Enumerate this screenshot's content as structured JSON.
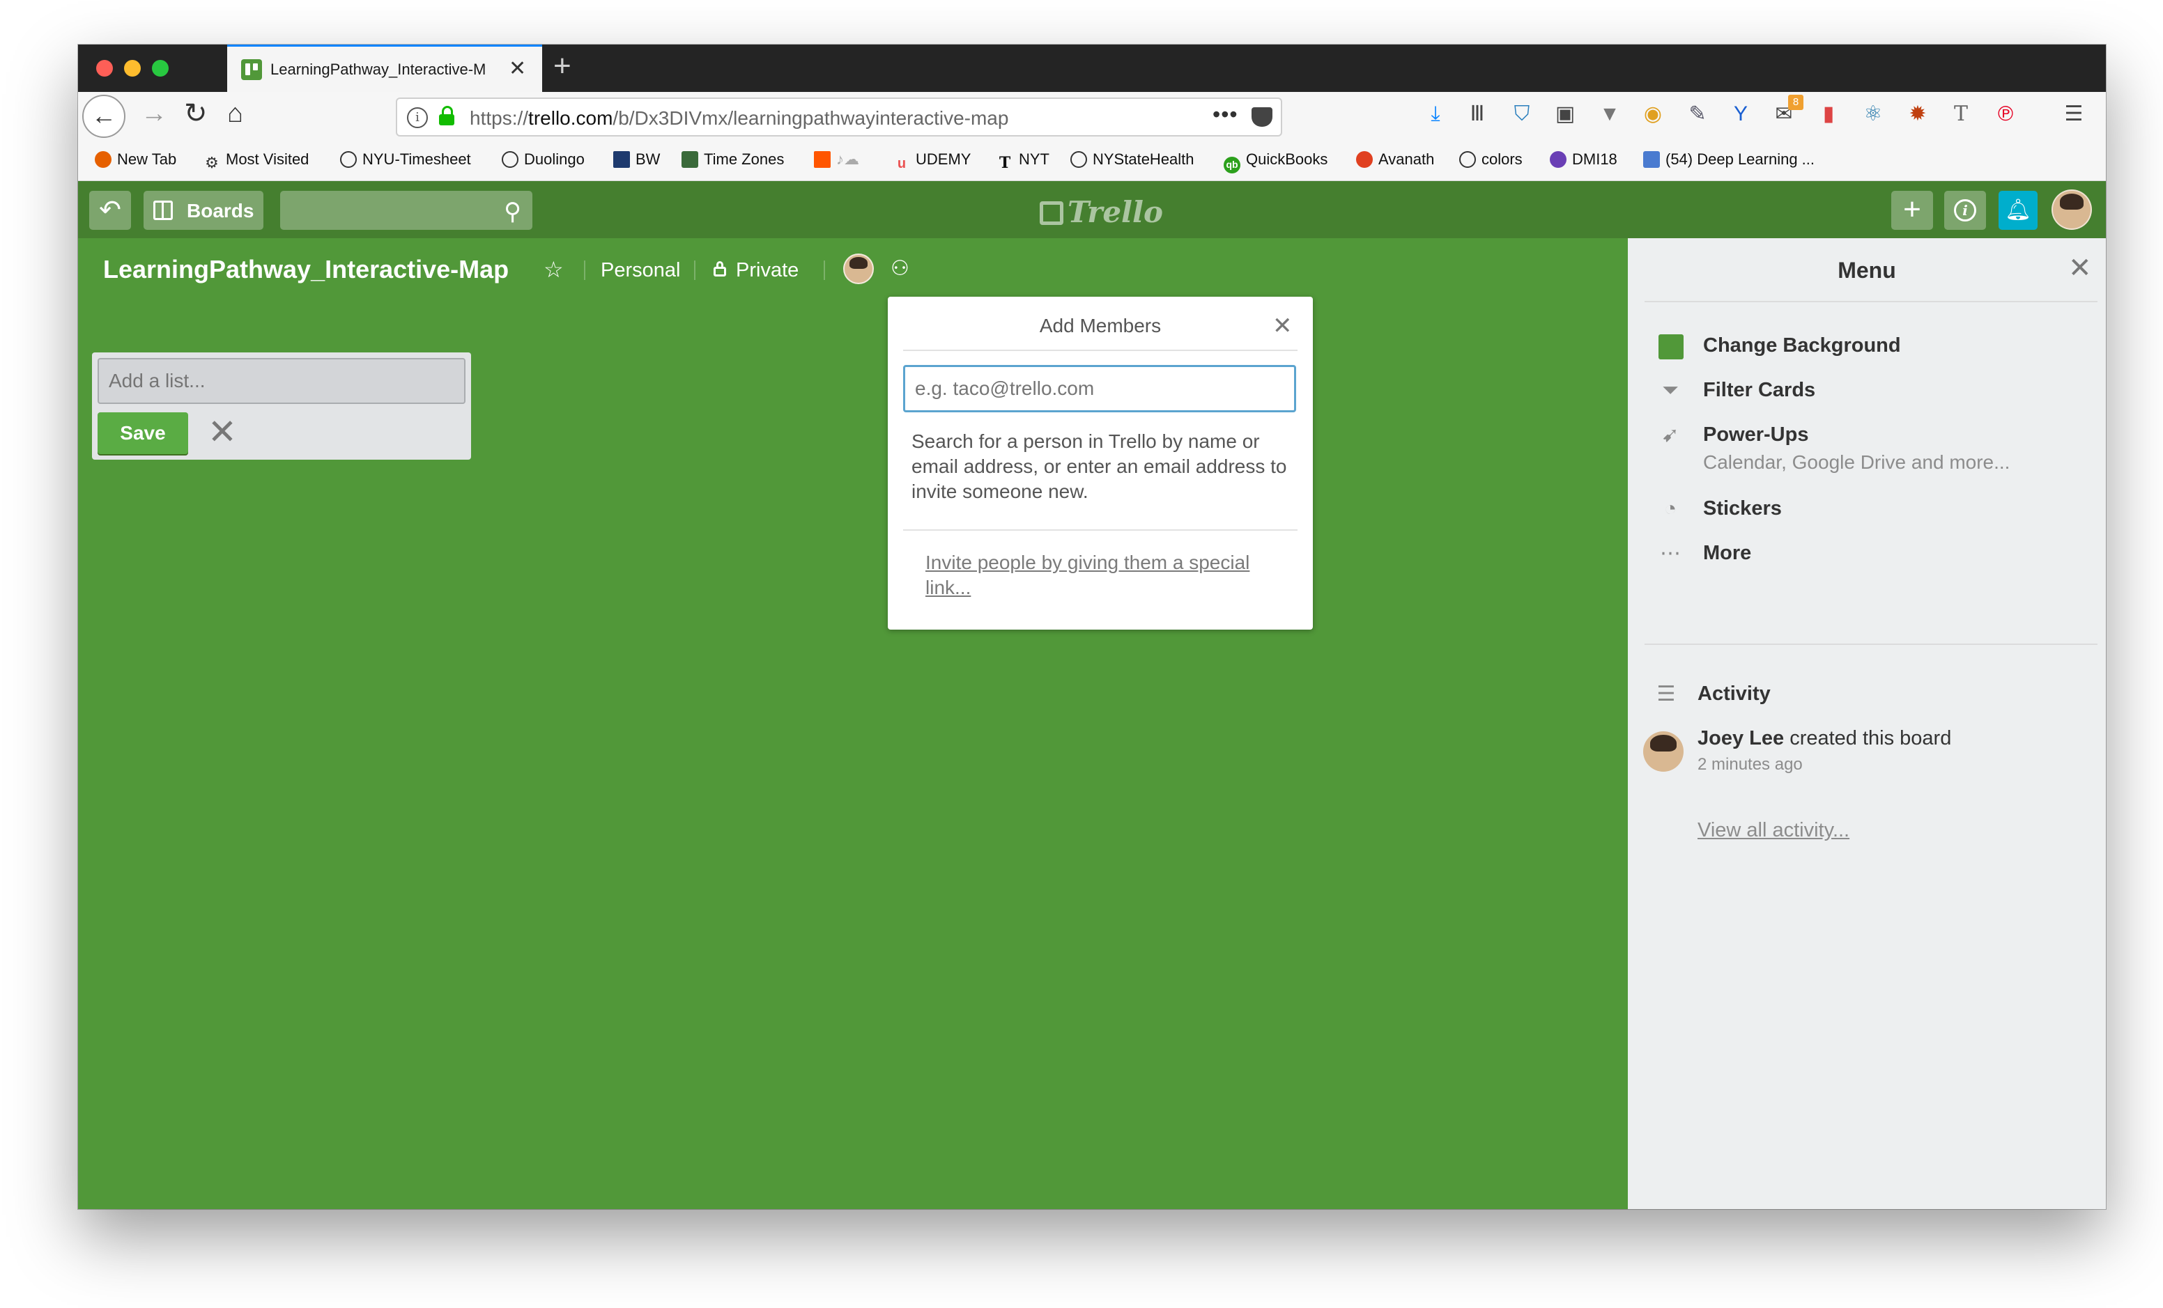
{
  "browser": {
    "tab_title": "LearningPathway_Interactive-M",
    "url_prefix": "https://",
    "url_domain": "trello.com",
    "url_path": "/b/Dx3DIVmx/learningpathwayinteractive-map",
    "bookmarks": [
      "New Tab",
      "Most Visited",
      "NYU-Timesheet",
      "Duolingo",
      "BW",
      "Time Zones",
      "UDEMY",
      "NYT",
      "NYStateHealth",
      "QuickBooks",
      "Avanath",
      "colors",
      "DMI18",
      "(54) Deep Learning ..."
    ],
    "badge_count": "8"
  },
  "header": {
    "boards_label": "Boards",
    "logo_text": "Trello"
  },
  "board": {
    "title": "LearningPathway_Interactive-Map",
    "team_label": "Personal",
    "visibility_label": "Private",
    "background_color": "#519839"
  },
  "add_list": {
    "placeholder": "Add a list...",
    "save_label": "Save"
  },
  "popover": {
    "title": "Add Members",
    "input_placeholder": "e.g. taco@trello.com",
    "help_text": "Search for a person in Trello by name or email address, or enter an email address to invite someone new.",
    "invite_link": "Invite people by giving them a special link..."
  },
  "menu": {
    "title": "Menu",
    "items": [
      {
        "label": "Change Background",
        "icon": "color-swatch-icon"
      },
      {
        "label": "Filter Cards",
        "icon": "filter-icon"
      },
      {
        "label": "Power-Ups",
        "sublabel": "Calendar, Google Drive and more...",
        "icon": "rocket-icon"
      },
      {
        "label": "Stickers",
        "icon": "sticker-icon"
      },
      {
        "label": "More",
        "icon": "ellipsis-icon"
      }
    ],
    "activity_label": "Activity",
    "activity_user": "Joey Lee",
    "activity_action": "created this board",
    "activity_time": "2 minutes ago",
    "view_all": "View all activity..."
  },
  "colors": {
    "header_green": "#457f2f",
    "board_green": "#519839",
    "save_green": "#5aac44",
    "bell_blue": "#00aecc",
    "input_focus_blue": "#5ba4cf"
  }
}
